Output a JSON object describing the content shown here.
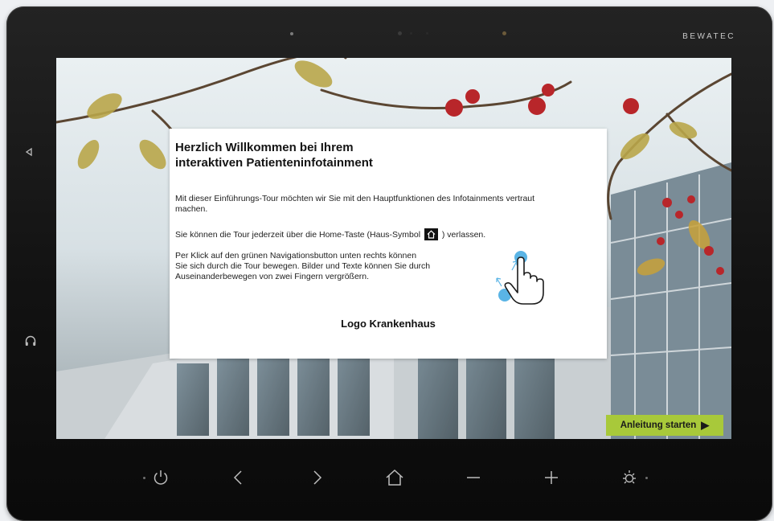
{
  "device": {
    "brand": "BEWATEC"
  },
  "dialog": {
    "title_line1": "Herzlich Willkommen bei Ihrem",
    "title_line2": "interaktiven Patienteninfotainment",
    "paragraph1": "Mit dieser Einführungs-Tour möchten wir Sie mit den Hauptfunktionen des Infotainments vertraut machen.",
    "paragraph2_before": "Sie können die Tour jederzeit über die Home-Taste (Haus-Symbol",
    "paragraph2_after": ") verlassen.",
    "paragraph3_line1": "Per Klick auf den grünen Navigationsbutton unten rechts können",
    "paragraph3_line2": "Sie sich durch die Tour bewegen. Bilder und Texte können Sie durch",
    "paragraph3_line3": "Auseinanderbewegen von zwei Fingern vergrößern.",
    "logo_text": "Logo Krankenhaus"
  },
  "start_button": {
    "label": "Anleitung starten",
    "icon": "play-triangle-icon",
    "color": "#a8c93a"
  },
  "hardware_buttons": [
    {
      "name": "power-icon"
    },
    {
      "name": "back-chevron-icon"
    },
    {
      "name": "forward-chevron-icon"
    },
    {
      "name": "home-icon"
    },
    {
      "name": "minus-icon"
    },
    {
      "name": "plus-icon"
    },
    {
      "name": "brightness-icon"
    }
  ],
  "side_buttons": [
    {
      "name": "side-back-icon"
    },
    {
      "name": "headphones-icon"
    }
  ]
}
